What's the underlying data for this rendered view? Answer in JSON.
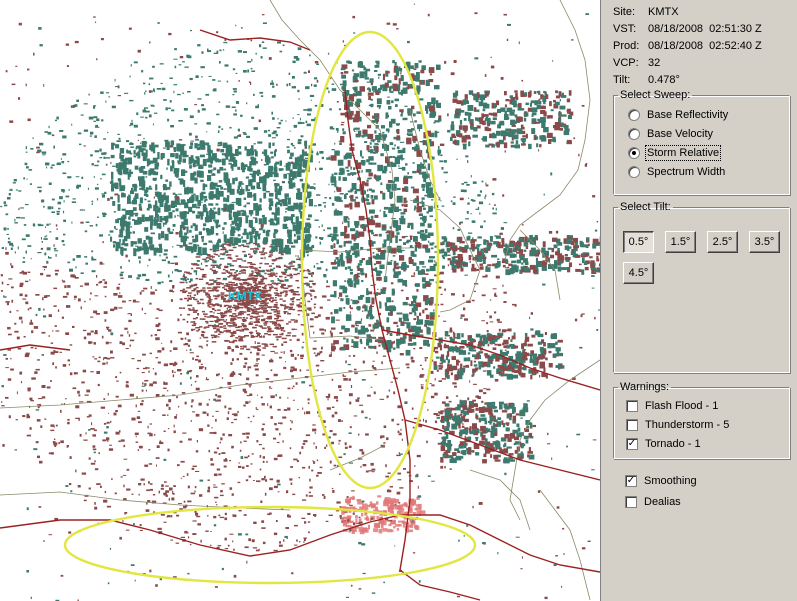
{
  "map": {
    "station_label": "KMTX",
    "colors": {
      "inbound": "#3d7a6e",
      "outbound": "#8b4a4a",
      "outbound_strong": "#e07878",
      "roads": "#9c2020",
      "borders": "#8a8a6a",
      "highlight_ellipse": "#e2e640",
      "station_label": "#14c8d8"
    }
  },
  "info": {
    "site": {
      "label": "Site:",
      "value": "KMTX"
    },
    "vst": {
      "label": "VST:",
      "value": "08/18/2008  02:51:30 Z"
    },
    "prod": {
      "label": "Prod:",
      "value": "08/18/2008  02:52:40 Z"
    },
    "vcp": {
      "label": "VCP:",
      "value": "32"
    },
    "tilt": {
      "label": "Tilt:",
      "value": "0.478°"
    }
  },
  "sweep": {
    "title": "Select Sweep:",
    "options": [
      {
        "label": "Base Reflectivity",
        "selected": false
      },
      {
        "label": "Base Velocity",
        "selected": false
      },
      {
        "label": "Storm Relative",
        "selected": true
      },
      {
        "label": "Spectrum Width",
        "selected": false
      }
    ]
  },
  "tilt": {
    "title": "Select Tilt:",
    "buttons": [
      {
        "label": "0.5°",
        "pressed": true
      },
      {
        "label": "1.5°",
        "pressed": false
      },
      {
        "label": "2.5°",
        "pressed": false
      },
      {
        "label": "3.5°",
        "pressed": false
      },
      {
        "label": "4.5°",
        "pressed": false
      }
    ]
  },
  "warnings": {
    "title": "Warnings:",
    "items": [
      {
        "label": "Flash Flood - 1",
        "checked": false
      },
      {
        "label": "Thunderstorm - 5",
        "checked": false
      },
      {
        "label": "Tornado - 1",
        "checked": true
      }
    ]
  },
  "options": {
    "smoothing": {
      "label": "Smoothing",
      "checked": true
    },
    "dealias": {
      "label": "Dealias",
      "checked": false
    }
  }
}
